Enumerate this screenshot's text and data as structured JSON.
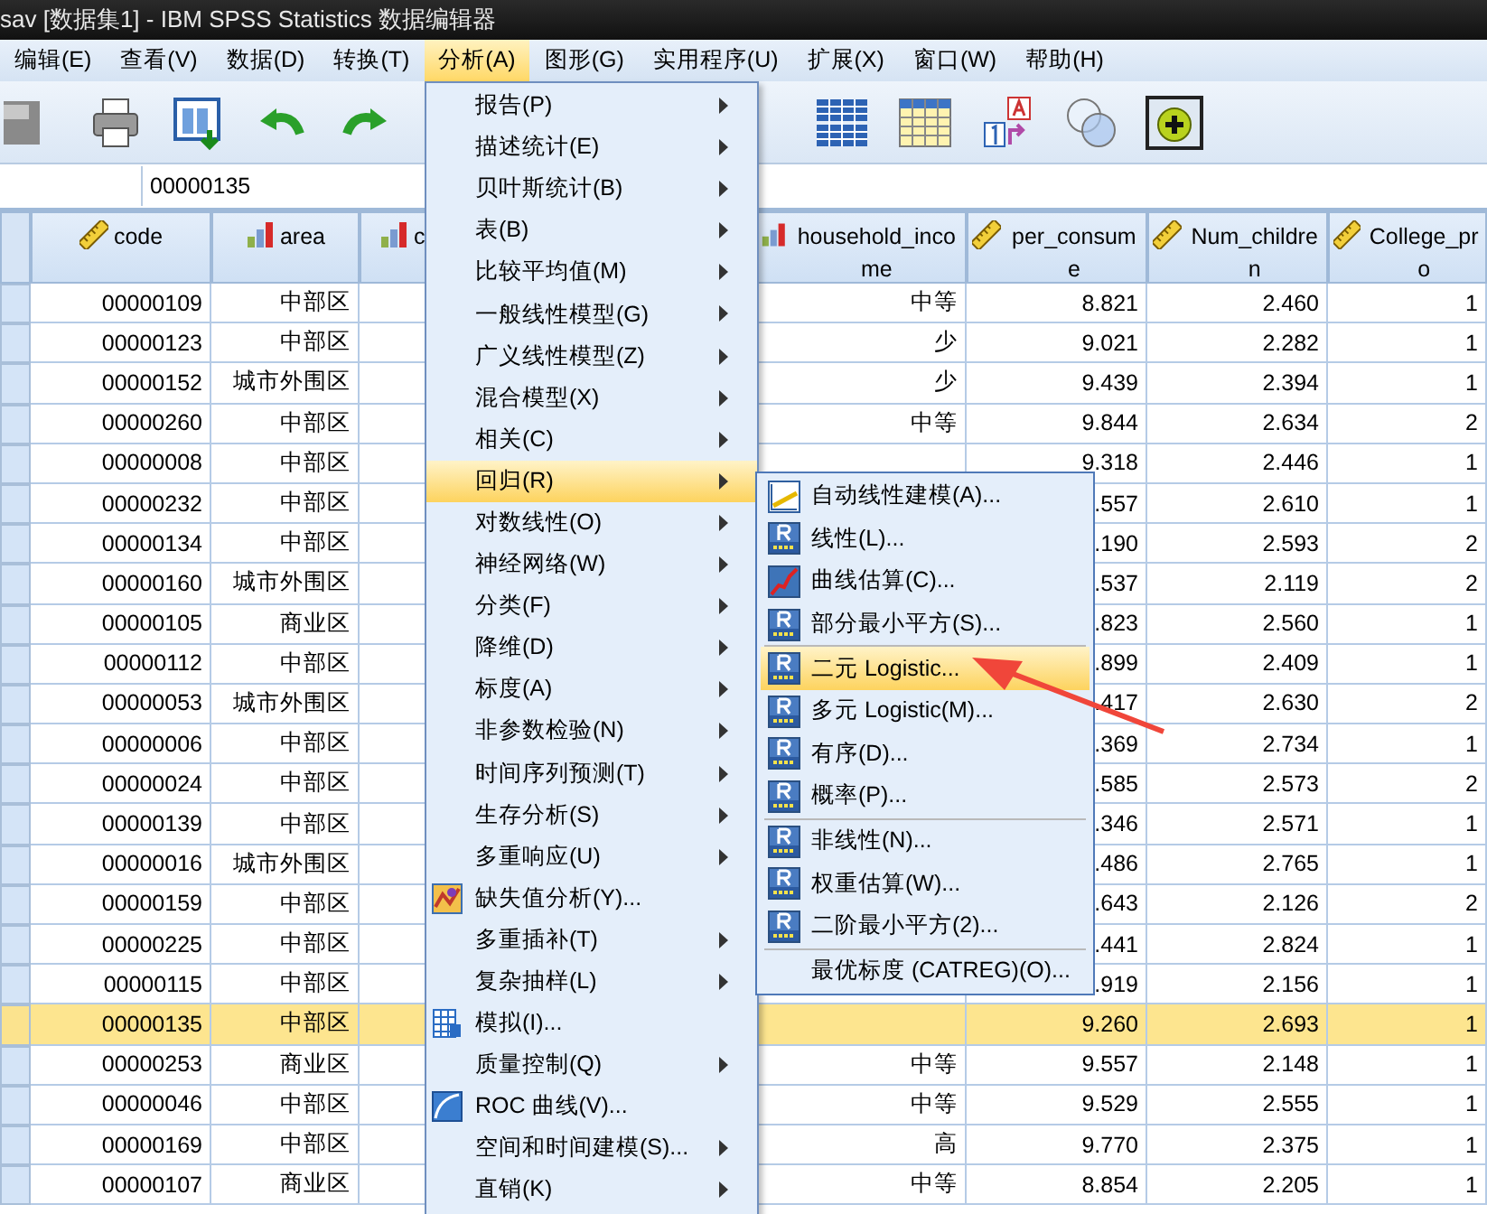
{
  "window": {
    "title": "sav [数据集1] - IBM SPSS Statistics 数据编辑器"
  },
  "menubar": [
    {
      "label": "编辑(E)",
      "selected": false
    },
    {
      "label": "查看(V)",
      "selected": false
    },
    {
      "label": "数据(D)",
      "selected": false
    },
    {
      "label": "转换(T)",
      "selected": false
    },
    {
      "label": "分析(A)",
      "selected": true
    },
    {
      "label": "图形(G)",
      "selected": false
    },
    {
      "label": "实用程序(U)",
      "selected": false
    },
    {
      "label": "扩展(X)",
      "selected": false
    },
    {
      "label": "窗口(W)",
      "selected": false
    },
    {
      "label": "帮助(H)",
      "selected": false
    }
  ],
  "cell_editor": {
    "value": "00000135"
  },
  "table": {
    "columns": [
      {
        "label": "code",
        "kind": "scale"
      },
      {
        "label": "area",
        "kind": "nominal"
      },
      {
        "label": "c",
        "kind": "nominal"
      },
      {
        "label": "household_income",
        "kind": "nominal"
      },
      {
        "label": "per_consume",
        "kind": "scale"
      },
      {
        "label": "Num_children",
        "kind": "scale"
      },
      {
        "label": "College_pro",
        "kind": "scale"
      }
    ],
    "rows": [
      {
        "selected": false,
        "cells": [
          "00000109",
          "中部区",
          "",
          "中等",
          "8.821",
          "2.460",
          "1"
        ]
      },
      {
        "selected": false,
        "cells": [
          "00000123",
          "中部区",
          "",
          "少",
          "9.021",
          "2.282",
          "1"
        ]
      },
      {
        "selected": false,
        "cells": [
          "00000152",
          "城市外围区",
          "",
          "少",
          "9.439",
          "2.394",
          "1"
        ]
      },
      {
        "selected": false,
        "cells": [
          "00000260",
          "中部区",
          "",
          "中等",
          "9.844",
          "2.634",
          "2"
        ]
      },
      {
        "selected": false,
        "cells": [
          "00000008",
          "中部区",
          "",
          "",
          "9.318",
          "2.446",
          "1"
        ]
      },
      {
        "selected": false,
        "cells": [
          "00000232",
          "中部区",
          "",
          "",
          ".557",
          "2.610",
          "1"
        ]
      },
      {
        "selected": false,
        "cells": [
          "00000134",
          "中部区",
          "",
          "",
          ".190",
          "2.593",
          "2"
        ]
      },
      {
        "selected": false,
        "cells": [
          "00000160",
          "城市外围区",
          "",
          "",
          ".537",
          "2.119",
          "2"
        ]
      },
      {
        "selected": false,
        "cells": [
          "00000105",
          "商业区",
          "",
          "",
          ".823",
          "2.560",
          "1"
        ]
      },
      {
        "selected": false,
        "cells": [
          "00000112",
          "中部区",
          "",
          "",
          ".899",
          "2.409",
          "1"
        ]
      },
      {
        "selected": false,
        "cells": [
          "00000053",
          "城市外围区",
          "",
          "",
          ".417",
          "2.630",
          "2"
        ]
      },
      {
        "selected": false,
        "cells": [
          "00000006",
          "中部区",
          "",
          "",
          ".369",
          "2.734",
          "1"
        ]
      },
      {
        "selected": false,
        "cells": [
          "00000024",
          "中部区",
          "",
          "",
          ".585",
          "2.573",
          "2"
        ]
      },
      {
        "selected": false,
        "cells": [
          "00000139",
          "中部区",
          "",
          "",
          ".346",
          "2.571",
          "1"
        ]
      },
      {
        "selected": false,
        "cells": [
          "00000016",
          "城市外围区",
          "",
          "",
          ".486",
          "2.765",
          "1"
        ]
      },
      {
        "selected": false,
        "cells": [
          "00000159",
          "中部区",
          "",
          "",
          ".643",
          "2.126",
          "2"
        ]
      },
      {
        "selected": false,
        "cells": [
          "00000225",
          "中部区",
          "",
          "",
          ".441",
          "2.824",
          "1"
        ]
      },
      {
        "selected": false,
        "cells": [
          "00000115",
          "中部区",
          "",
          "",
          ".919",
          "2.156",
          "1"
        ]
      },
      {
        "selected": true,
        "cells": [
          "00000135",
          "中部区",
          "",
          "",
          "9.260",
          "2.693",
          "1"
        ]
      },
      {
        "selected": false,
        "cells": [
          "00000253",
          "商业区",
          "",
          "中等",
          "9.557",
          "2.148",
          "1"
        ]
      },
      {
        "selected": false,
        "cells": [
          "00000046",
          "中部区",
          "",
          "中等",
          "9.529",
          "2.555",
          "1"
        ]
      },
      {
        "selected": false,
        "cells": [
          "00000169",
          "中部区",
          "",
          "高",
          "9.770",
          "2.375",
          "1"
        ]
      },
      {
        "selected": false,
        "cells": [
          "00000107",
          "商业区",
          "",
          "中等",
          "8.854",
          "2.205",
          "1"
        ]
      }
    ]
  },
  "analyze_menu": [
    {
      "label": "报告(P)",
      "kind": "submenu",
      "selected": false
    },
    {
      "label": "描述统计(E)",
      "kind": "submenu",
      "selected": false
    },
    {
      "label": "贝叶斯统计(B)",
      "kind": "submenu",
      "selected": false
    },
    {
      "label": "表(B)",
      "kind": "submenu",
      "selected": false
    },
    {
      "label": "比较平均值(M)",
      "kind": "submenu",
      "selected": false
    },
    {
      "label": "一般线性模型(G)",
      "kind": "submenu",
      "selected": false
    },
    {
      "label": "广义线性模型(Z)",
      "kind": "submenu",
      "selected": false
    },
    {
      "label": "混合模型(X)",
      "kind": "submenu",
      "selected": false
    },
    {
      "label": "相关(C)",
      "kind": "submenu",
      "selected": false
    },
    {
      "label": "回归(R)",
      "kind": "submenu",
      "selected": true
    },
    {
      "label": "对数线性(O)",
      "kind": "submenu",
      "selected": false
    },
    {
      "label": "神经网络(W)",
      "kind": "submenu",
      "selected": false
    },
    {
      "label": "分类(F)",
      "kind": "submenu",
      "selected": false
    },
    {
      "label": "降维(D)",
      "kind": "submenu",
      "selected": false
    },
    {
      "label": "标度(A)",
      "kind": "submenu",
      "selected": false
    },
    {
      "label": "非参数检验(N)",
      "kind": "submenu",
      "selected": false
    },
    {
      "label": "时间序列预测(T)",
      "kind": "submenu",
      "selected": false
    },
    {
      "label": "生存分析(S)",
      "kind": "submenu",
      "selected": false
    },
    {
      "label": "多重响应(U)",
      "kind": "submenu",
      "selected": false
    },
    {
      "label": "缺失值分析(Y)...",
      "kind": "missing",
      "selected": false
    },
    {
      "label": "多重插补(T)",
      "kind": "submenu",
      "selected": false
    },
    {
      "label": "复杂抽样(L)",
      "kind": "submenu",
      "selected": false
    },
    {
      "label": "模拟(I)...",
      "kind": "simulation",
      "selected": false
    },
    {
      "label": "质量控制(Q)",
      "kind": "submenu",
      "selected": false
    },
    {
      "label": "ROC 曲线(V)...",
      "kind": "roc",
      "selected": false
    },
    {
      "label": "空间和时间建模(S)...",
      "kind": "submenu",
      "selected": false
    },
    {
      "label": "直销(K)",
      "kind": "submenu",
      "selected": false
    }
  ],
  "regression_menu": [
    {
      "label": "自动线性建模(A)...",
      "kind": "auto",
      "selected": false
    },
    {
      "label": "线性(L)...",
      "kind": "r",
      "selected": false
    },
    {
      "label": "曲线估算(C)...",
      "kind": "curve",
      "selected": false
    },
    {
      "label": "部分最小平方(S)...",
      "kind": "r",
      "selected": false
    },
    {
      "kind": "separator"
    },
    {
      "label": "二元 Logistic...",
      "kind": "r",
      "selected": true
    },
    {
      "label": "多元 Logistic(M)...",
      "kind": "r",
      "selected": false
    },
    {
      "label": "有序(D)...",
      "kind": "r",
      "selected": false
    },
    {
      "label": "概率(P)...",
      "kind": "r",
      "selected": false
    },
    {
      "kind": "separator"
    },
    {
      "label": "非线性(N)...",
      "kind": "r",
      "selected": false
    },
    {
      "label": "权重估算(W)...",
      "kind": "r",
      "selected": false
    },
    {
      "label": "二阶最小平方(2)...",
      "kind": "r",
      "selected": false
    },
    {
      "kind": "separator"
    },
    {
      "label": "最优标度 (CATREG)(O)...",
      "kind": "plain",
      "selected": false
    }
  ]
}
